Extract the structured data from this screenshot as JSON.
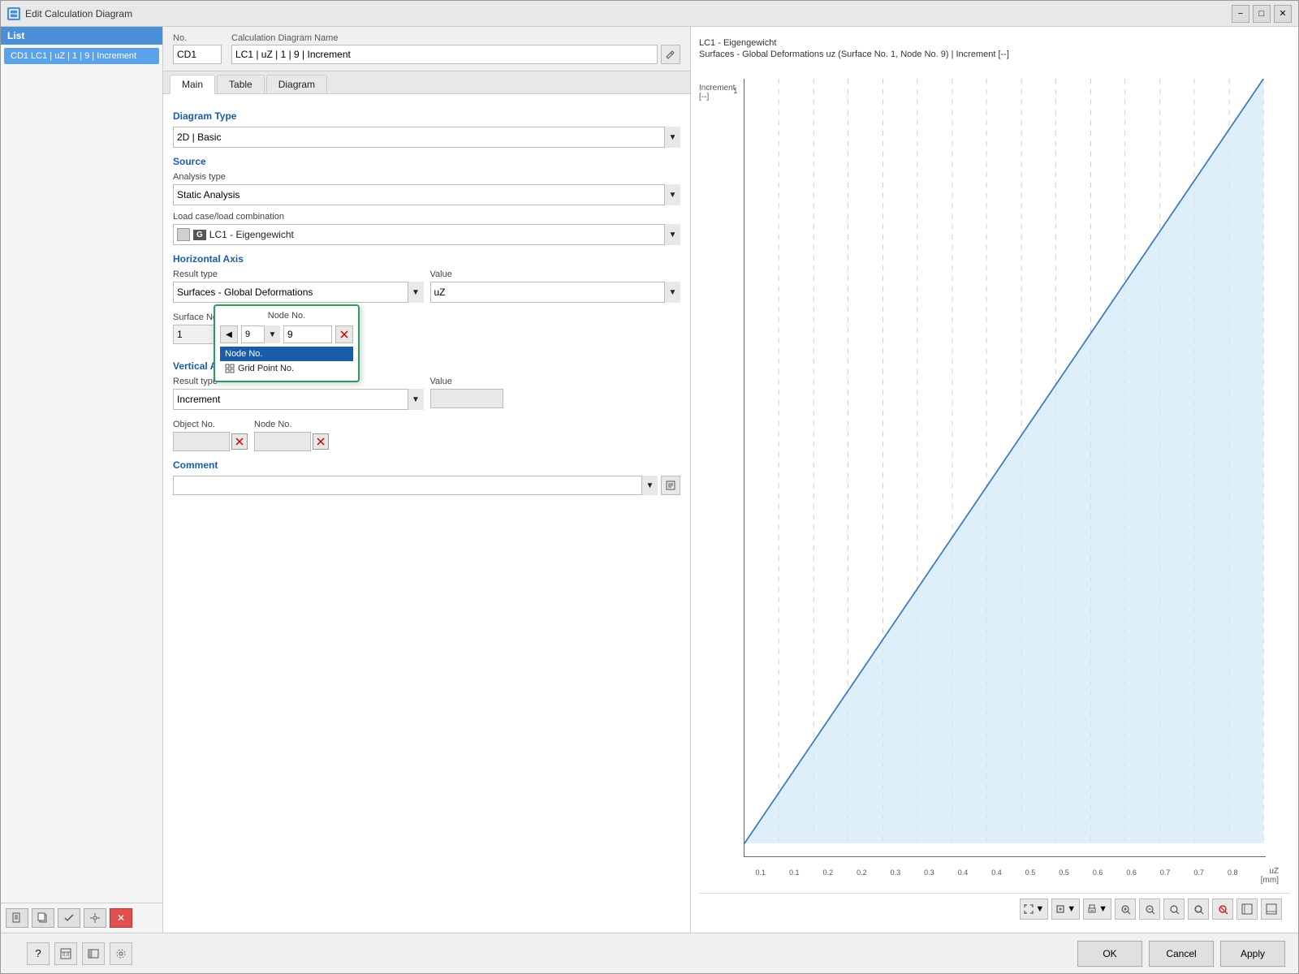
{
  "window": {
    "title": "Edit Calculation Diagram",
    "minimize_label": "−",
    "maximize_label": "□",
    "close_label": "✕"
  },
  "list": {
    "header": "List",
    "item": "CD1  LC1 | uZ | 1 | 9 | Increment"
  },
  "no_section": {
    "no_label": "No.",
    "no_value": "CD1",
    "name_label": "Calculation Diagram Name",
    "name_value": "LC1 | uZ | 1 | 9 | Increment"
  },
  "tabs": {
    "main_label": "Main",
    "table_label": "Table",
    "diagram_label": "Diagram"
  },
  "diagram_type": {
    "label": "Diagram Type",
    "value": "2D | Basic"
  },
  "source": {
    "label": "Source",
    "analysis_type_label": "Analysis type",
    "analysis_type_value": "Static Analysis",
    "lc_label": "Load case/load combination",
    "lc_color": "#000000",
    "lc_badge": "G",
    "lc_value": "LC1 - Eigengewicht"
  },
  "horizontal_axis": {
    "label": "Horizontal Axis",
    "result_type_label": "Result type",
    "result_type_value": "Surfaces - Global Deformations",
    "value_label": "Value",
    "value_value": "uZ",
    "surface_no_label": "Surface No.",
    "surface_no_value": "1",
    "node_no_popup": {
      "header": "Node No.",
      "input_value": "9",
      "option1": "Node No.",
      "option2": "Grid Point No."
    }
  },
  "vertical_axis": {
    "label": "Vertical Axis",
    "result_type_label": "Result type",
    "result_type_value": "Increment",
    "value_label": "Value",
    "object_no_label": "Object No.",
    "node_no_label": "Node No."
  },
  "comment": {
    "label": "Comment"
  },
  "chart": {
    "title1": "LC1 - Eigengewicht",
    "title2": "Surfaces - Global Deformations uz (Surface No. 1, Node No. 9) | Increment [--]",
    "y_axis_label": "Increment",
    "y_axis_unit": "[--]",
    "x_axis_label": "uZ",
    "x_axis_unit": "[mm]",
    "y_max": "1",
    "x_ticks": [
      "0.1",
      "0.1",
      "0.2",
      "0.2",
      "0.3",
      "0.3",
      "0.4",
      "0.4",
      "0.5",
      "0.5",
      "0.6",
      "0.6",
      "0.7",
      "0.7",
      "0.8"
    ]
  },
  "bottom_bar": {
    "ok_label": "OK",
    "cancel_label": "Cancel",
    "apply_label": "Apply"
  }
}
